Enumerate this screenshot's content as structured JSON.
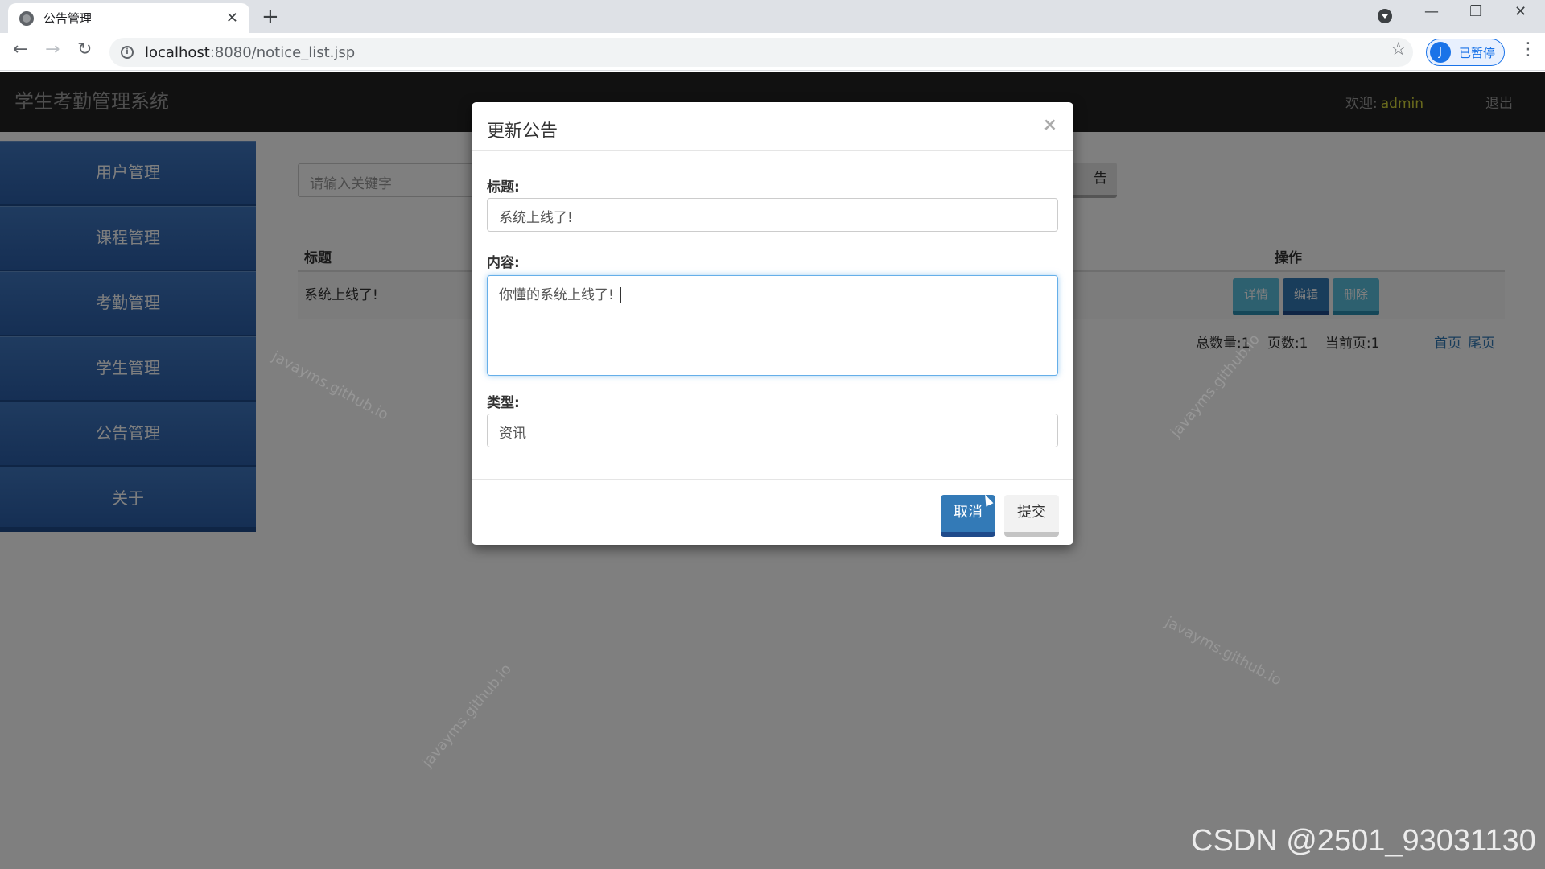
{
  "browser": {
    "tab_title": "公告管理",
    "url_host": "localhost",
    "url_rest": ":8080/notice_list.jsp",
    "profile_initial": "J",
    "profile_label": "已暂停"
  },
  "app": {
    "brand": "学生考勤管理系统",
    "welcome_label": "欢迎:",
    "username": "admin",
    "logout": "退出"
  },
  "sidebar": {
    "items": [
      {
        "label": "用户管理"
      },
      {
        "label": "课程管理"
      },
      {
        "label": "考勤管理"
      },
      {
        "label": "学生管理"
      },
      {
        "label": "公告管理"
      },
      {
        "label": "关于"
      }
    ]
  },
  "main": {
    "search_placeholder": "请输入关键字",
    "add_button_visible": "告",
    "table": {
      "headers": [
        "标题",
        "操作"
      ],
      "rows": [
        {
          "title": "系统上线了!"
        }
      ]
    },
    "row_actions": {
      "detail": "详情",
      "edit": "编辑",
      "delete": "删除"
    },
    "pager": {
      "total": "总数量:1",
      "pages": "页数:1",
      "current": "当前页:1",
      "first": "首页",
      "last": "尾页"
    }
  },
  "modal": {
    "title": "更新公告",
    "close": "×",
    "title_label": "标题:",
    "title_value": "系统上线了!",
    "content_label": "内容:",
    "content_value": "你懂的系统上线了!",
    "type_label": "类型:",
    "type_value": "资讯",
    "cancel": "取消",
    "submit": "提交"
  },
  "watermark_text": "javayms.github.io",
  "footer_watermark": "CSDN @2501_93031130",
  "colors": {
    "topbar": "#222222",
    "sidebar": "#2b5ea8",
    "primary": "#337ab7",
    "info": "#5bc0de",
    "username": "#d4d73a"
  }
}
